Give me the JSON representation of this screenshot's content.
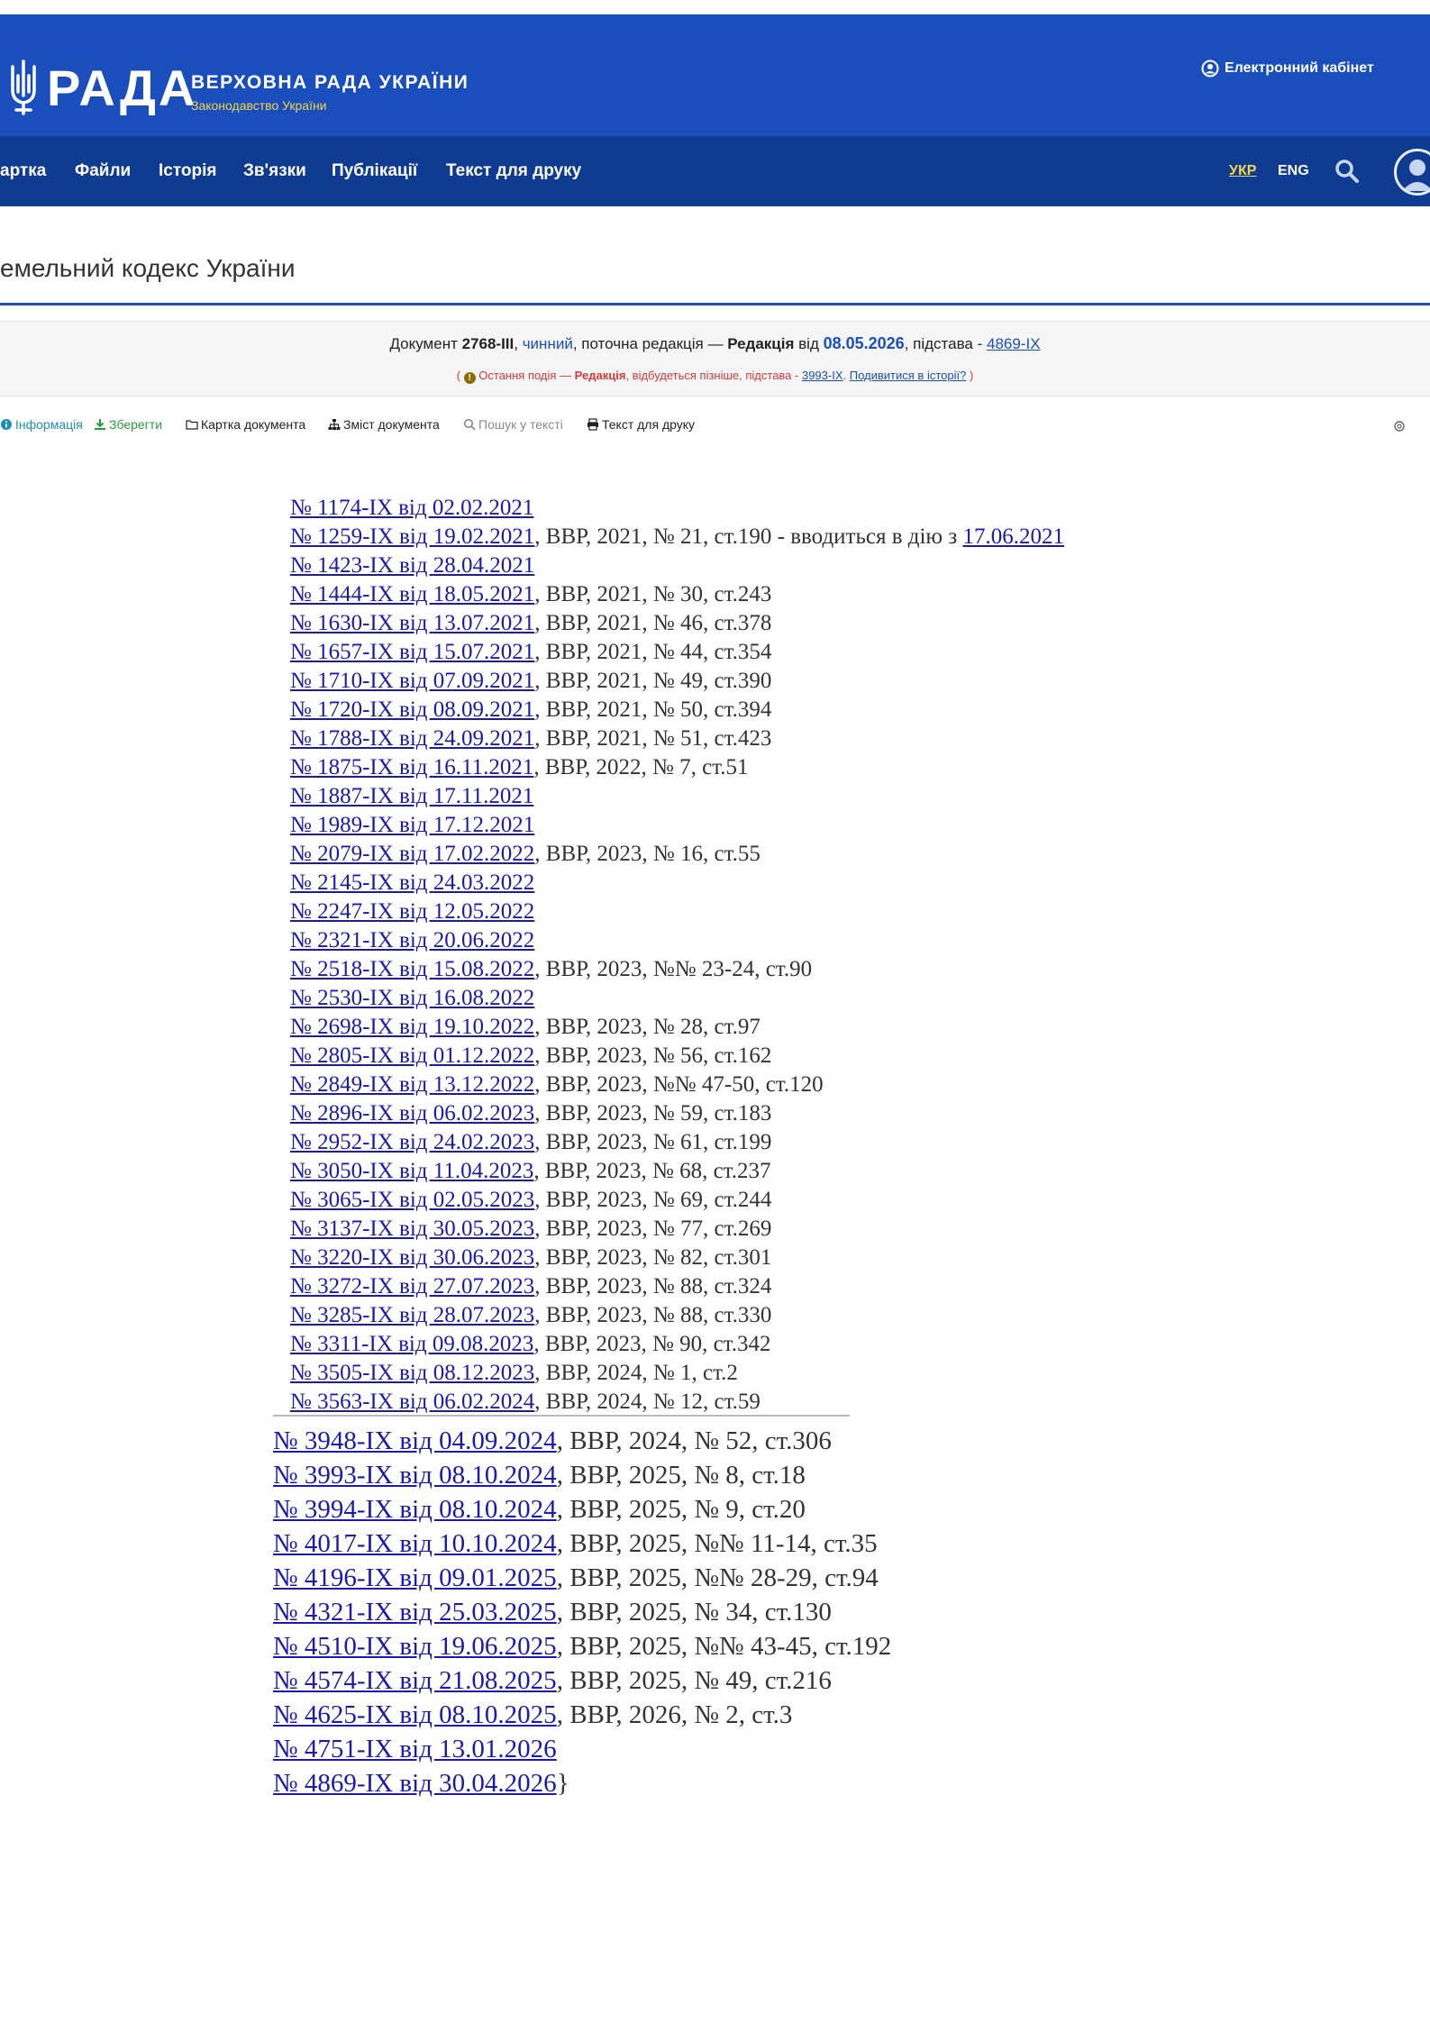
{
  "header": {
    "brand_word": "РАДА",
    "brand_title": "ВЕРХОВНА РАДА УКРАЇНИ",
    "brand_subtitle": "Законодавство України",
    "cabinet_label": "Електронний кабінет"
  },
  "nav": {
    "items": [
      "артка",
      "Файли",
      "Історія",
      "Зв'язки",
      "Публікації",
      "Текст для друку"
    ],
    "lang_ukr": "УКР",
    "lang_eng": "ENG"
  },
  "page_title": "емельний кодекс України",
  "info": {
    "doc_prefix": "Документ ",
    "doc_number": "2768-III",
    "sep1": ", ",
    "status": "чинний",
    "mid": ", поточна редакція — ",
    "redaction_label": "Редакція",
    "from": " від ",
    "redaction_date": "08.05.2026",
    "basis_prefix": ", підстава - ",
    "basis_link": "4869-IX",
    "event_open": "( ",
    "event_text1": "Остання подія — ",
    "event_bold": "Редакція",
    "event_text2": ", відбудеться пізніше, підстава - ",
    "event_link": "3993-IX",
    "event_sep": ". ",
    "event_history": "Подивитися в історії?",
    "event_close": " )"
  },
  "toolbar": {
    "info": "Інформація",
    "save": "Зберегти",
    "card": "Картка документа",
    "contents": "Зміст документа",
    "search": "Пошук у тексті",
    "print": "Текст для друку"
  },
  "amendments_a": [
    {
      "link": "№ 1174-IX від 02.02.2021",
      "tail": ""
    },
    {
      "link": "№ 1259-IX від 19.02.2021",
      "tail": ", ВВР, 2021, № 21, ст.190 - вводиться в дію з ",
      "link2": "17.06.2021"
    },
    {
      "link": "№ 1423-IX від 28.04.2021",
      "tail": ""
    },
    {
      "link": "№ 1444-IX від 18.05.2021",
      "tail": ", ВВР, 2021, № 30, ст.243"
    },
    {
      "link": "№ 1630-IX від 13.07.2021",
      "tail": ", ВВР, 2021, № 46, ст.378"
    },
    {
      "link": "№ 1657-IX від 15.07.2021",
      "tail": ", ВВР, 2021, № 44, ст.354"
    },
    {
      "link": "№ 1710-IX від 07.09.2021",
      "tail": ", ВВР, 2021, № 49, ст.390"
    },
    {
      "link": "№ 1720-IX від 08.09.2021",
      "tail": ", ВВР, 2021, № 50, ст.394"
    },
    {
      "link": "№ 1788-IX від 24.09.2021",
      "tail": ", ВВР, 2021, № 51, ст.423"
    },
    {
      "link": "№ 1875-IX від 16.11.2021",
      "tail": ", ВВР, 2022, № 7, ст.51"
    },
    {
      "link": "№ 1887-IX від 17.11.2021",
      "tail": ""
    },
    {
      "link": "№ 1989-IX від 17.12.2021",
      "tail": ""
    },
    {
      "link": "№ 2079-IX від 17.02.2022",
      "tail": ", ВВР, 2023, № 16, ст.55"
    },
    {
      "link": "№ 2145-IX від 24.03.2022",
      "tail": ""
    },
    {
      "link": "№ 2247-IX від 12.05.2022",
      "tail": ""
    },
    {
      "link": "№ 2321-IX від 20.06.2022",
      "tail": ""
    },
    {
      "link": "№ 2518-IX від 15.08.2022",
      "tail": ", ВВР, 2023, №№ 23-24, ст.90"
    },
    {
      "link": "№ 2530-IX від 16.08.2022",
      "tail": ""
    },
    {
      "link": "№ 2698-IX від 19.10.2022",
      "tail": ", ВВР, 2023, № 28, ст.97"
    },
    {
      "link": "№ 2805-IX від 01.12.2022",
      "tail": ", ВВР, 2023, № 56, ст.162"
    },
    {
      "link": "№ 2849-IX від 13.12.2022",
      "tail": ", ВВР, 2023, №№ 47-50, ст.120"
    },
    {
      "link": "№ 2896-IX від 06.02.2023",
      "tail": ", ВВР, 2023, № 59, ст.183"
    },
    {
      "link": "№ 2952-IX від 24.02.2023",
      "tail": ", ВВР, 2023, № 61, ст.199"
    },
    {
      "link": "№ 3050-IX від 11.04.2023",
      "tail": ", ВВР, 2023, № 68, ст.237"
    },
    {
      "link": "№ 3065-IX від 02.05.2023",
      "tail": ", ВВР, 2023, № 69, ст.244"
    },
    {
      "link": "№ 3137-IX від 30.05.2023",
      "tail": ", ВВР, 2023, № 77, ст.269"
    },
    {
      "link": "№ 3220-IX від 30.06.2023",
      "tail": ", ВВР, 2023, № 82, ст.301"
    },
    {
      "link": "№ 3272-IX від 27.07.2023",
      "tail": ", ВВР, 2023, № 88, ст.324"
    },
    {
      "link": "№ 3285-IX від 28.07.2023",
      "tail": ", ВВР, 2023, № 88, ст.330"
    },
    {
      "link": "№ 3311-IX від 09.08.2023",
      "tail": ", ВВР, 2023, № 90, ст.342"
    },
    {
      "link": "№ 3505-IX від 08.12.2023",
      "tail": ", ВВР, 2024, № 1, ст.2"
    },
    {
      "link": "№ 3563-IX від 06.02.2024",
      "tail": ", ВВР, 2024, № 12, ст.59"
    }
  ],
  "amendments_b": [
    {
      "link": "№ 3948-IX від 04.09.2024",
      "tail": ", ВВР, 2024, № 52, ст.306"
    },
    {
      "link": "№ 3993-IX від 08.10.2024",
      "tail": ", ВВР, 2025, № 8, ст.18"
    },
    {
      "link": "№ 3994-IX від 08.10.2024",
      "tail": ", ВВР, 2025, № 9, ст.20"
    },
    {
      "link": "№ 4017-IX від 10.10.2024",
      "tail": ", ВВР, 2025, №№ 11-14, ст.35"
    },
    {
      "link": "№ 4196-IX від 09.01.2025",
      "tail": ", ВВР, 2025, №№ 28-29, ст.94"
    },
    {
      "link": "№ 4321-IX від 25.03.2025",
      "tail": ", ВВР, 2025, № 34, ст.130"
    },
    {
      "link": "№ 4510-IX від 19.06.2025",
      "tail": ", ВВР, 2025, №№ 43-45, ст.192"
    },
    {
      "link": "№ 4574-IX від 21.08.2025",
      "tail": ", ВВР, 2025, № 49, ст.216"
    },
    {
      "link": "№ 4625-IX від 08.10.2025",
      "tail": ", ВВР, 2026, № 2, ст.3"
    },
    {
      "link": "№ 4751-IX від 13.01.2026",
      "tail": ""
    },
    {
      "link": "№ 4869-IX від 30.04.2026",
      "tail": "}"
    }
  ],
  "colors": {
    "header_blue": "#1a4ebd",
    "nav_blue": "#0f3b91",
    "accent_yellow": "#f3d44a",
    "link_blue": "#1a1ab0"
  }
}
